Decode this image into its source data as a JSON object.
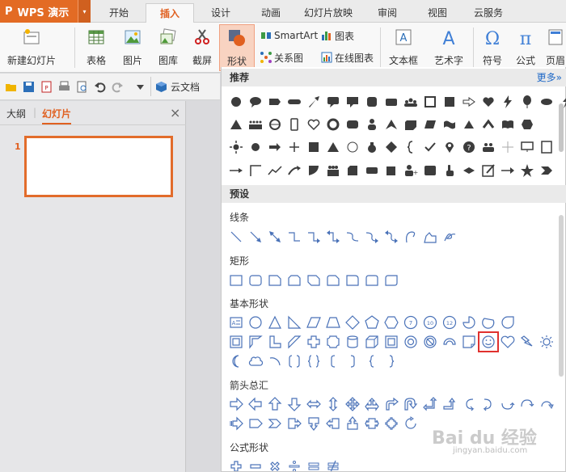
{
  "app": {
    "logo": "P",
    "title": "WPS 演示",
    "menu_arrow": "▾"
  },
  "tabs": [
    "开始",
    "插入",
    "设计",
    "动画",
    "幻灯片放映",
    "审阅",
    "视图",
    "云服务"
  ],
  "active_tab": "插入",
  "ribbon": {
    "new_slide": "新建幻灯片",
    "table": "表格",
    "picture": "图片",
    "gallery": "图库",
    "screenshot": "截屏",
    "shapes": "形状",
    "smartart": "SmartArt",
    "chart": "图表",
    "relation": "关系图",
    "online_chart": "在线图表",
    "textbox": "文本框",
    "wordart": "艺术字",
    "symbol": "符号",
    "formula": "公式",
    "header_footer": "页眉"
  },
  "quick_access": {
    "cloud_doc": "云文档"
  },
  "left_pane": {
    "tab_outline": "大纲",
    "tab_slides": "幻灯片",
    "slide_number": "1",
    "close": "×"
  },
  "dropdown": {
    "recommended": "推荐",
    "more": "更多»",
    "preset": "预设",
    "lines": "线条",
    "rectangles": "矩形",
    "basic_shapes": "基本形状",
    "block_arrows": "箭头总汇",
    "equation_shapes": "公式形状"
  },
  "watermark": {
    "text": "Bai du 经验",
    "sub": "jingyan.baidu.com"
  },
  "colors": {
    "accent": "#e36b24",
    "shape_outline": "#4a72b8",
    "shape_fill": "#3c3c3c",
    "highlight": "#e0312e"
  }
}
